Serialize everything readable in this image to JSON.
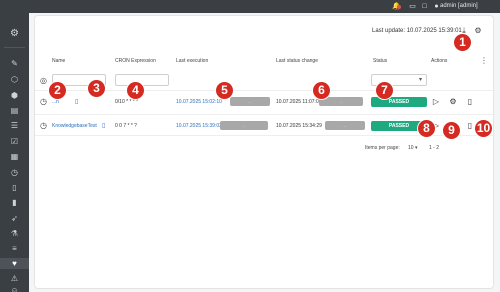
{
  "topbar": {
    "icons": [
      "bell-icon",
      "monitor-icon",
      "chat-icon",
      "user-icon"
    ],
    "user_label": "admin [admin]"
  },
  "sidebar": {
    "icons": [
      "gear-icon",
      "edit-icon",
      "cube-icon",
      "cubes-icon",
      "database-icon",
      "list-icon",
      "tasks-icon",
      "calendar-icon",
      "clock-icon",
      "file-icon",
      "file-code-icon",
      "rocket-icon",
      "flask-icon",
      "chart-icon",
      "heartbeat-icon",
      "warning-icon",
      "user-icon"
    ],
    "active_index": 14
  },
  "header": {
    "last_update": "Last update: 10.07.2025 15:39:01"
  },
  "table": {
    "columns": [
      "Name",
      "CRON Expression",
      "Last execution",
      "Last status change",
      "Status",
      "Actions"
    ],
    "filter_select_value": "",
    "rows": [
      {
        "name": "...n",
        "cron": "0/10 * * * *",
        "last_execution": "10.07.2025 15:02:10",
        "last_execution_badge": "...",
        "last_status_change": "10.07.2025 11:07:07",
        "status_change_badge": "...",
        "status": "PASSED"
      },
      {
        "name": "KnowledgebaseTest",
        "cron": "0 0 7 * * ?",
        "last_execution": "10.07.2025 15:39:03",
        "last_execution_badge": "...",
        "last_status_change": "10.07.2025 15:34:29",
        "status_change_badge": "...",
        "status": "PASSED"
      }
    ]
  },
  "pager": {
    "label": "Items per page:",
    "size": "10",
    "range": "1 - 2"
  },
  "markers": [
    "1",
    "2",
    "3",
    "4",
    "5",
    "6",
    "7",
    "8",
    "9",
    "10"
  ],
  "colors": {
    "chrome": "#3a3f44",
    "link": "#2a6ebb",
    "passed": "#1fa980",
    "marker": "#d42a22"
  }
}
